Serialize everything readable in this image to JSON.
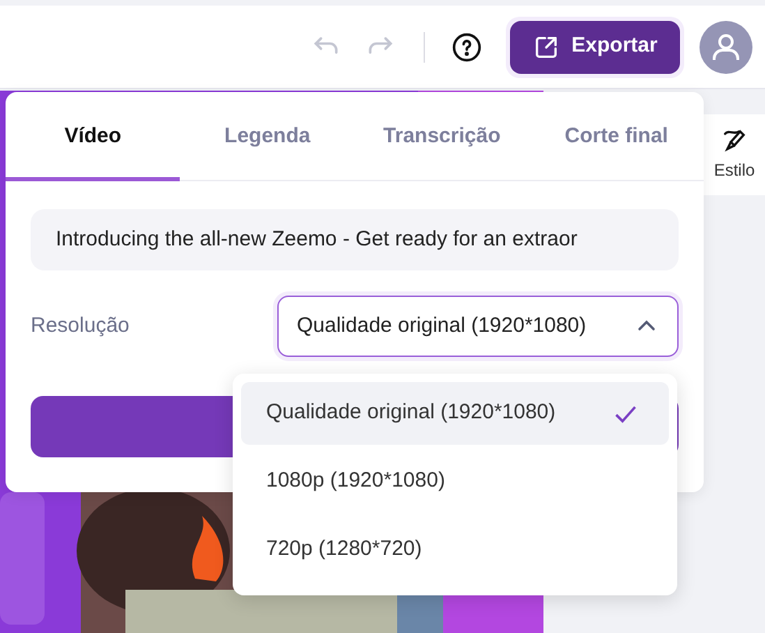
{
  "toolbar": {
    "undo": {
      "disabled": true
    },
    "redo": {
      "disabled": true
    },
    "export_button": {
      "label": "Exportar"
    }
  },
  "side_tool": {
    "label": "Estilo"
  },
  "export_panel": {
    "tabs": [
      {
        "label": "Vídeo",
        "selected": true
      },
      {
        "label": "Legenda",
        "selected": false
      },
      {
        "label": "Transcrição",
        "selected": false
      },
      {
        "label": "Corte final",
        "selected": false
      }
    ],
    "title_field": {
      "value": "Introducing the all-new Zeemo - Get ready for an extraor"
    },
    "resolution": {
      "label": "Resolução",
      "value": "Qualidade original (1920*1080)",
      "expanded": true,
      "options": [
        {
          "label": "Qualidade original (1920*1080)",
          "selected": true
        },
        {
          "label": "1080p (1920*1080)",
          "selected": false
        },
        {
          "label": "720p (1280*720)",
          "selected": false
        }
      ]
    }
  }
}
